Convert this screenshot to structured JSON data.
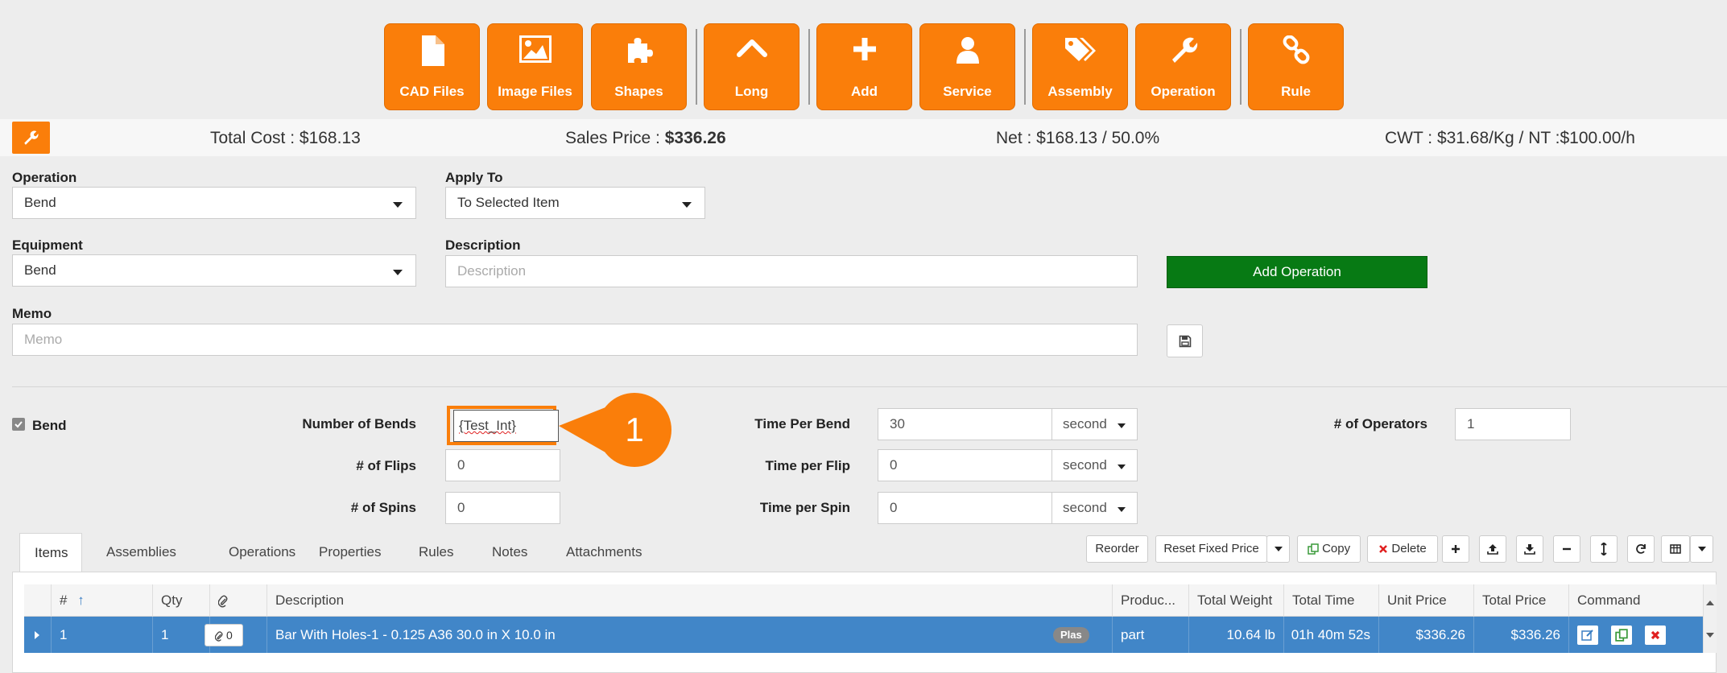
{
  "toolbar": {
    "buttons": [
      {
        "label": "CAD Files",
        "icon": "file-icon"
      },
      {
        "label": "Image Files",
        "icon": "image-icon"
      },
      {
        "label": "Shapes",
        "icon": "puzzle-icon"
      },
      {
        "label": "Long",
        "icon": "chevron-up-icon"
      },
      {
        "label": "Add",
        "icon": "plus-icon"
      },
      {
        "label": "Service",
        "icon": "user-icon"
      },
      {
        "label": "Assembly",
        "icon": "tags-icon"
      },
      {
        "label": "Operation",
        "icon": "wrench-icon"
      },
      {
        "label": "Rule",
        "icon": "link-icon"
      }
    ]
  },
  "summary": {
    "total_cost_label": "Total Cost :",
    "total_cost_value": "$168.13",
    "sales_price_label": "Sales Price :",
    "sales_price_value": "$336.26",
    "net": "Net : $168.13 / 50.0%",
    "cwt": "CWT : $31.68/Kg / NT :$100.00/h"
  },
  "form": {
    "operation_label": "Operation",
    "operation_value": "Bend",
    "apply_to_label": "Apply To",
    "apply_to_value": "To Selected Item",
    "equipment_label": "Equipment",
    "equipment_value": "Bend",
    "description_label": "Description",
    "description_placeholder": "Description",
    "add_operation_label": "Add Operation",
    "memo_label": "Memo",
    "memo_placeholder": "Memo"
  },
  "bend": {
    "checkbox_label": "Bend",
    "number_of_bends_label": "Number of Bends",
    "number_of_bends_value": "{Test_Int}",
    "flips_label": "# of Flips",
    "flips_value": "0",
    "spins_label": "# of Spins",
    "spins_value": "0",
    "time_per_bend_label": "Time Per Bend",
    "time_per_bend_value": "30",
    "time_per_bend_unit": "second",
    "time_per_flip_label": "Time per Flip",
    "time_per_flip_value": "0",
    "time_per_flip_unit": "second",
    "time_per_spin_label": "Time per Spin",
    "time_per_spin_value": "0",
    "time_per_spin_unit": "second",
    "operators_label": "# of Operators",
    "operators_value": "1",
    "callout_number": "1"
  },
  "tabs": [
    "Items",
    "Assemblies",
    "Operations",
    "Properties",
    "Rules",
    "Notes",
    "Attachments"
  ],
  "grid_toolbar": {
    "reorder": "Reorder",
    "reset_fixed_price": "Reset Fixed Price",
    "copy": "Copy",
    "delete": "Delete"
  },
  "grid": {
    "columns": [
      "#",
      "Qty",
      "Description",
      "Produc...",
      "Total Weight",
      "Total Time",
      "Unit Price",
      "Total Price",
      "Command"
    ],
    "rows": [
      {
        "num": "1",
        "qty": "1",
        "attachments": "0",
        "description": "Bar With Holes-1 - 0.125 A36 30.0 in X 10.0 in",
        "badge": "Plas",
        "product": "part",
        "total_weight": "10.64 lb",
        "total_time": "01h 40m 52s",
        "unit_price": "$336.26",
        "total_price": "$336.26"
      }
    ]
  },
  "colors": {
    "accent": "#fa7e0a",
    "add_operation": "#077a14",
    "selected_row": "#4186c8"
  }
}
